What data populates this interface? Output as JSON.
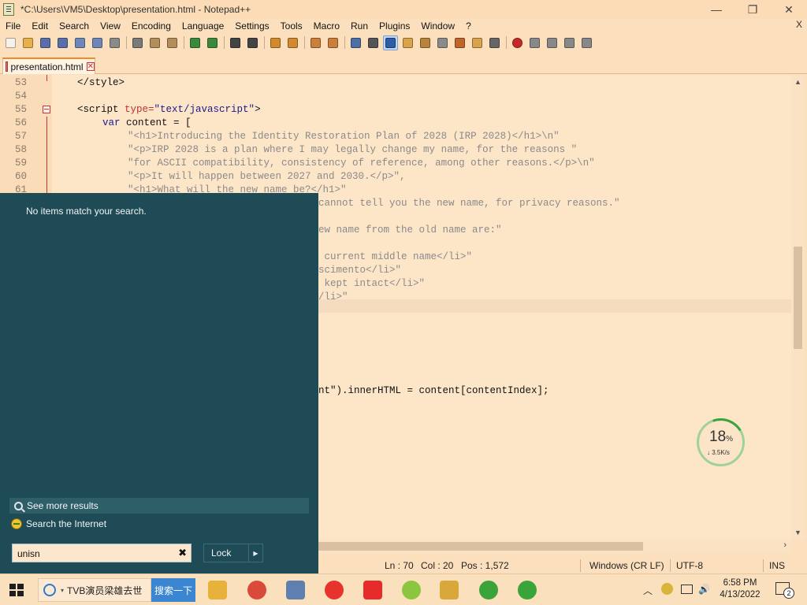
{
  "window": {
    "title": "*C:\\Users\\VM5\\Desktop\\presentation.html - Notepad++",
    "minimize": "—",
    "maximize": "❐",
    "close": "✕"
  },
  "menu": {
    "items": [
      "File",
      "Edit",
      "Search",
      "View",
      "Encoding",
      "Language",
      "Settings",
      "Tools",
      "Macro",
      "Run",
      "Plugins",
      "Window",
      "?"
    ],
    "close_doc": "X"
  },
  "toolbar": {
    "buttons": [
      {
        "icon": "new-file-icon",
        "color": "#f7f2e8"
      },
      {
        "icon": "open-file-icon",
        "color": "#e8b04a"
      },
      {
        "icon": "save-icon",
        "color": "#5a6fa8"
      },
      {
        "icon": "save-all-icon",
        "color": "#5a6fa8"
      },
      {
        "icon": "close-file-icon",
        "color": "#6f86b8"
      },
      {
        "icon": "close-all-icon",
        "color": "#6f86b8"
      },
      {
        "icon": "print-icon",
        "color": "#8a8a8a"
      },
      {
        "icon": "cut-icon",
        "color": "#7a7a7a"
      },
      {
        "icon": "copy-icon",
        "color": "#b38d5a"
      },
      {
        "icon": "paste-icon",
        "color": "#b38d5a"
      },
      {
        "icon": "undo-icon",
        "color": "#3b8a3b"
      },
      {
        "icon": "redo-icon",
        "color": "#3b8a3b"
      },
      {
        "icon": "find-icon",
        "color": "#444444"
      },
      {
        "icon": "replace-icon",
        "color": "#444444"
      },
      {
        "icon": "zoom-in-icon",
        "color": "#d28a2e"
      },
      {
        "icon": "zoom-out-icon",
        "color": "#d28a2e"
      },
      {
        "icon": "sync-vertical-icon",
        "color": "#c9803a"
      },
      {
        "icon": "sync-horizontal-icon",
        "color": "#c9803a"
      },
      {
        "icon": "word-wrap-icon",
        "color": "#4e6fa5"
      },
      {
        "icon": "show-all-chars-icon",
        "color": "#555555"
      },
      {
        "icon": "indent-guide-icon",
        "color": "#2d5da8"
      },
      {
        "icon": "user-lang-icon",
        "color": "#d8a34a"
      },
      {
        "icon": "doc-map-icon",
        "color": "#b8843c"
      },
      {
        "icon": "doc-list-icon",
        "color": "#8a8a8a"
      },
      {
        "icon": "function-list-icon",
        "color": "#c0652a"
      },
      {
        "icon": "folder-workspace-icon",
        "color": "#d8a34a"
      },
      {
        "icon": "monitoring-icon",
        "color": "#666666"
      },
      {
        "icon": "record-macro-icon",
        "color": "#c62828"
      },
      {
        "icon": "stop-record-icon",
        "color": "#888888"
      },
      {
        "icon": "play-macro-icon",
        "color": "#888888"
      },
      {
        "icon": "run-macro-multiple-icon",
        "color": "#888888"
      },
      {
        "icon": "save-macro-icon",
        "color": "#888888"
      }
    ]
  },
  "tab": {
    "label": "presentation.html",
    "close": "✕"
  },
  "editor": {
    "lines": [
      {
        "n": "53",
        "parts": [
          [
            "punct",
            "</style>"
          ]
        ],
        "indent": 0
      },
      {
        "n": "54",
        "parts": [],
        "indent": 0
      },
      {
        "n": "55",
        "parts": [
          [
            "punct",
            "<script "
          ],
          [
            "attr",
            "type="
          ],
          [
            "kw",
            "\"text/javascript\""
          ],
          [
            "punct",
            ">"
          ]
        ],
        "indent": 0
      },
      {
        "n": "56",
        "parts": [
          [
            "kw",
            "var "
          ],
          [
            "punct",
            "content = ["
          ]
        ],
        "indent": 1
      },
      {
        "n": "57",
        "parts": [
          [
            "str",
            "\"<h1>Introducing the Identity Restoration Plan of 2028 (IRP 2028)</h1>\\n\""
          ]
        ],
        "indent": 2
      },
      {
        "n": "58",
        "parts": [
          [
            "str",
            "\"<p>IRP 2028 is a plan where I may legally change my name, for the reasons \""
          ]
        ],
        "indent": 2
      },
      {
        "n": "59",
        "parts": [
          [
            "str",
            "\"for ASCII compatibility, consistency of reference, among other reasons.</p>\\n\""
          ]
        ],
        "indent": 2
      },
      {
        "n": "60",
        "parts": [
          [
            "str",
            "\"<p>It will happen between 2027 and 2030.</p>\","
          ]
        ],
        "indent": 2
      },
      {
        "n": "61",
        "parts": [
          [
            "str",
            "\"<h1>What will the new name be?</h1>\""
          ]
        ],
        "indent": 2
      }
    ],
    "visible_fragments": [
      {
        "text": "cannot tell you the new name, for privacy reasons.\"",
        "row": 9
      },
      {
        "text": "ew name from the old name are:\"",
        "row": 11
      },
      {
        "text": " current middle name</li>\"",
        "row": 13
      },
      {
        "text": "scimento</li>\"",
        "row": 14
      },
      {
        "text": " kept intact</li>\"",
        "row": 15
      },
      {
        "text": "/li>\"",
        "row": 16
      },
      {
        "text": "nt\").innerHTML = content[contentIndex];",
        "row": 23
      }
    ]
  },
  "statusbar": {
    "ln": "Ln : 70",
    "col": "Col : 20",
    "pos": "Pos : 1,572",
    "eol": "Windows (CR LF)",
    "encoding": "UTF-8",
    "mode": "INS"
  },
  "startmenu": {
    "no_items": "No items match your search.",
    "see_more": "See more results",
    "search_internet": "Search the Internet",
    "query": "unisn",
    "clear": "✖",
    "lock": "Lock",
    "lock_arrow": "▶"
  },
  "netwidget": {
    "percent": "18",
    "percent_sign": "%",
    "speed": "↓ 3.5K/s"
  },
  "taskbar": {
    "ie_search_text": "TVB演员梁雄去世",
    "ie_chevron": "▾",
    "ie_go": "搜索一下",
    "apps": [
      {
        "name": "file-explorer-icon",
        "color": "#e8b23a"
      },
      {
        "name": "chrome-icon",
        "color": "#d94a3a"
      },
      {
        "name": "notepad-plus-plus-icon",
        "color": "#5e7fb0"
      },
      {
        "name": "yandex-browser-icon",
        "color": "#e7332b"
      },
      {
        "name": "yandex-icon",
        "color": "#e72a2a"
      },
      {
        "name": "sync-app-icon",
        "color": "#8cc63f"
      },
      {
        "name": "chart-app-icon",
        "color": "#d9a73a"
      },
      {
        "name": "plus-app-icon",
        "color": "#3aa33a"
      },
      {
        "name": "plus-app-2-icon",
        "color": "#3aa33a"
      }
    ],
    "tray": {
      "chevron": "︿",
      "volume": "🔊",
      "time": "6:58 PM",
      "date": "4/13/2022",
      "notifications": "2"
    }
  }
}
